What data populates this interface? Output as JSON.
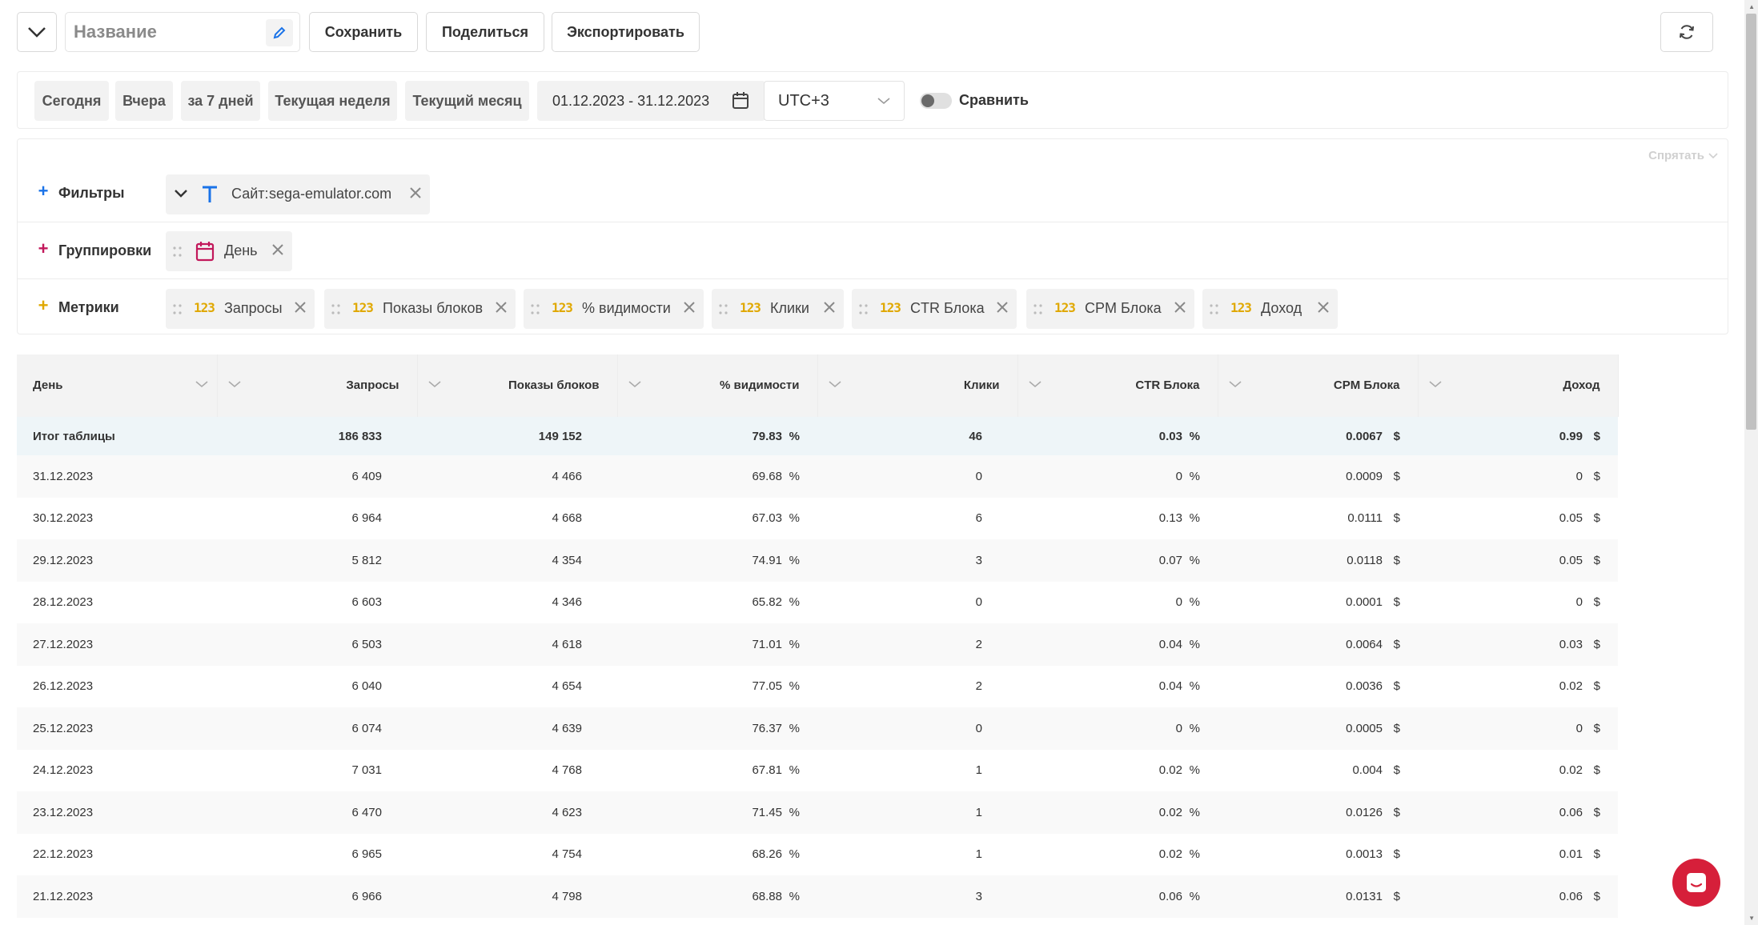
{
  "toolbar": {
    "name_placeholder": "Название",
    "save_label": "Сохранить",
    "share_label": "Поделиться",
    "export_label": "Экспортировать"
  },
  "period": {
    "presets": [
      "Сегодня",
      "Вчера",
      "за 7 дней",
      "Текущая неделя",
      "Текущий месяц"
    ],
    "date_range": "01.12.2023 - 31.12.2023",
    "timezone": "UTC+3",
    "compare_label": "Сравнить",
    "compare_enabled": false
  },
  "config": {
    "hide_label": "Спрятать",
    "filters": {
      "label": "Фильтры",
      "plus_color": "#1a73e8",
      "items": [
        {
          "key": "Сайт:",
          "value": "sega-emulator.com"
        }
      ]
    },
    "groupings": {
      "label": "Группировки",
      "plus_color": "#c2185b",
      "items": [
        "День"
      ]
    },
    "metrics": {
      "label": "Метрики",
      "plus_color": "#e0a800",
      "icon_text": "123",
      "items": [
        "Запросы",
        "Показы блоков",
        "% видимости",
        "Клики",
        "CTR Блока",
        "CPM Блока",
        "Доход"
      ]
    }
  },
  "table": {
    "columns": [
      "День",
      "Запросы",
      "Показы блоков",
      "% видимости",
      "Клики",
      "CTR Блока",
      "CPM Блока",
      "Доход"
    ],
    "units": [
      "",
      "",
      "",
      "%",
      "",
      "%",
      "$",
      "$"
    ],
    "total_label": "Итог таблицы",
    "total": [
      "186 833",
      "149 152",
      "79.83",
      "46",
      "0.03",
      "0.0067",
      "0.99"
    ],
    "rows": [
      [
        "31.12.2023",
        "6 409",
        "4 466",
        "69.68",
        "0",
        "0",
        "0.0009",
        "0"
      ],
      [
        "30.12.2023",
        "6 964",
        "4 668",
        "67.03",
        "6",
        "0.13",
        "0.0111",
        "0.05"
      ],
      [
        "29.12.2023",
        "5 812",
        "4 354",
        "74.91",
        "3",
        "0.07",
        "0.0118",
        "0.05"
      ],
      [
        "28.12.2023",
        "6 603",
        "4 346",
        "65.82",
        "0",
        "0",
        "0.0001",
        "0"
      ],
      [
        "27.12.2023",
        "6 503",
        "4 618",
        "71.01",
        "2",
        "0.04",
        "0.0064",
        "0.03"
      ],
      [
        "26.12.2023",
        "6 040",
        "4 654",
        "77.05",
        "2",
        "0.04",
        "0.0036",
        "0.02"
      ],
      [
        "25.12.2023",
        "6 074",
        "4 639",
        "76.37",
        "0",
        "0",
        "0.0005",
        "0"
      ],
      [
        "24.12.2023",
        "7 031",
        "4 768",
        "67.81",
        "1",
        "0.02",
        "0.004",
        "0.02"
      ],
      [
        "23.12.2023",
        "6 470",
        "4 623",
        "71.45",
        "1",
        "0.02",
        "0.0126",
        "0.06"
      ],
      [
        "22.12.2023",
        "6 965",
        "4 754",
        "68.26",
        "1",
        "0.02",
        "0.0013",
        "0.01"
      ],
      [
        "21.12.2023",
        "6 966",
        "4 798",
        "68.88",
        "3",
        "0.06",
        "0.0131",
        "0.06"
      ]
    ]
  },
  "colors": {
    "accent_blue": "#1a73e8",
    "chat_red": "#d61f3a",
    "metric_yellow": "#e0a800",
    "group_pink": "#c2185b"
  }
}
